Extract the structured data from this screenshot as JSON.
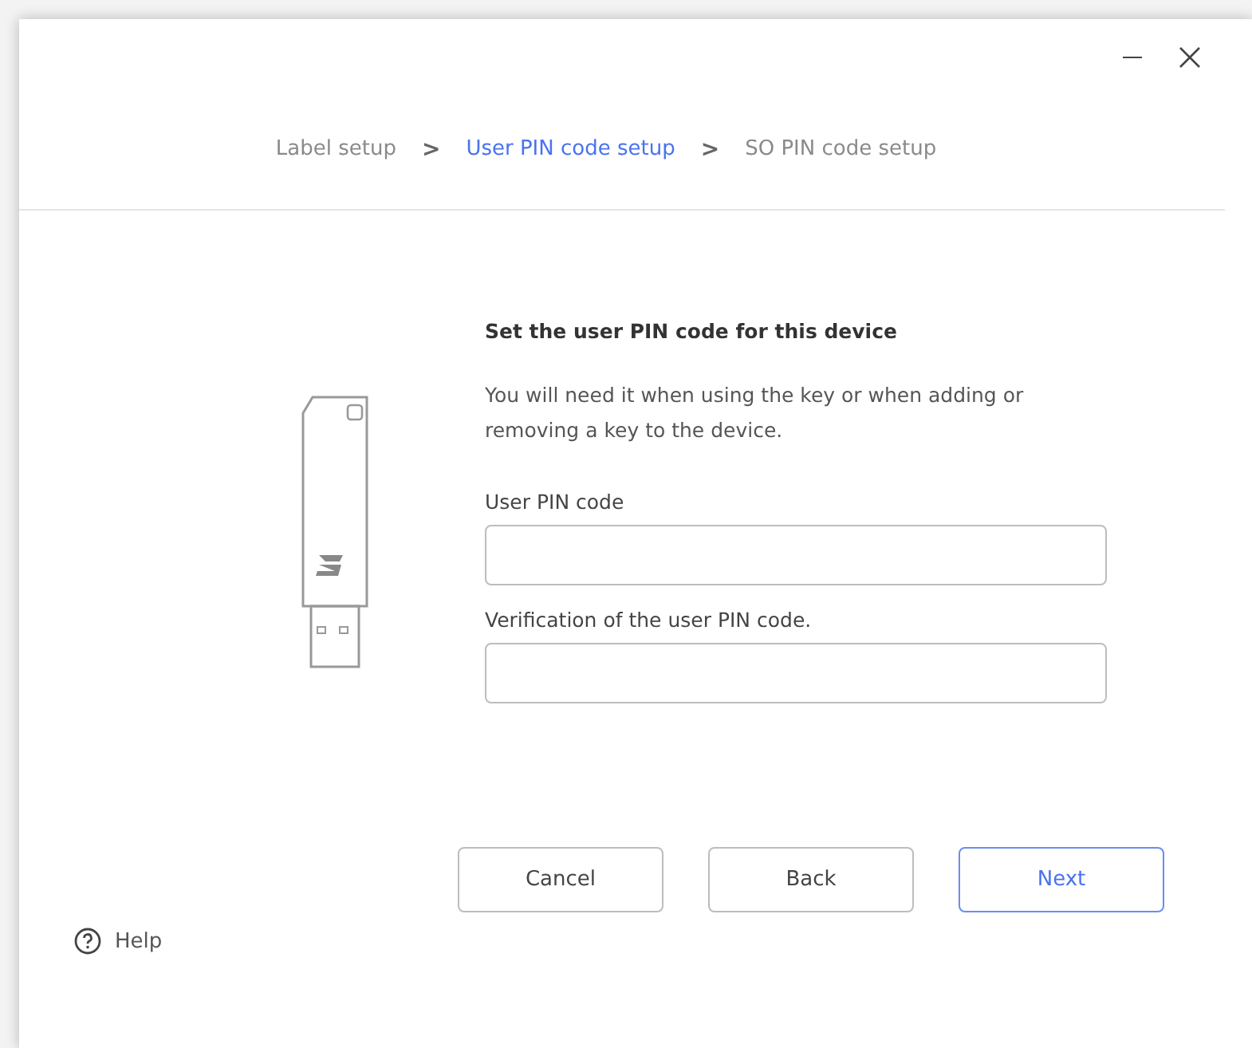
{
  "steps": [
    {
      "label": "Label setup",
      "selected": false
    },
    {
      "label": "User PIN code setup",
      "selected": true
    },
    {
      "label": "SO PIN code setup",
      "selected": false
    }
  ],
  "separator": ">",
  "heading": "Set the user PIN code for this device",
  "description": "You will need it when using the key or when adding or removing a key to the device.",
  "fields": [
    {
      "label": "User PIN code"
    },
    {
      "label": "Verification of the user PIN code."
    }
  ],
  "buttons": [
    {
      "label": "Cancel",
      "primary": false
    },
    {
      "label": "Back",
      "primary": false
    },
    {
      "label": "Next",
      "primary": true
    }
  ],
  "help": "Help"
}
